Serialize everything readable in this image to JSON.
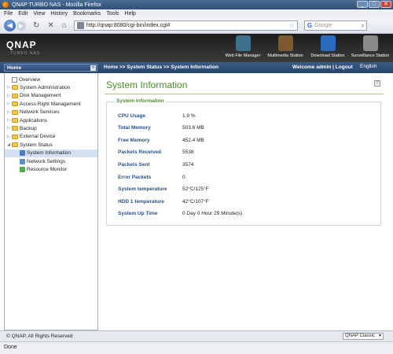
{
  "window": {
    "title": "QNAP TURBO NAS - Mozilla Firefox",
    "controls": [
      "_",
      "□",
      "✕"
    ]
  },
  "menu": [
    "File",
    "Edit",
    "View",
    "History",
    "Bookmarks",
    "Tools",
    "Help"
  ],
  "toolbar": {
    "url": "http://qnap:8080/cgi-bin/index.cgi#",
    "search_placeholder": "Google",
    "search_logo": "G"
  },
  "brand": {
    "logo": "QNAP",
    "sub": "TURBO NAS"
  },
  "apps": [
    {
      "label": "Web File Manager",
      "color": "#3d6f8f"
    },
    {
      "label": "Multimedia Station",
      "color": "#7b5a32"
    },
    {
      "label": "Download Station",
      "color": "#2b6cc0"
    },
    {
      "label": "Surveillance Station",
      "color": "#8a8a8a"
    }
  ],
  "nav": {
    "home_label": "Home",
    "breadcrumb": "Home >> System Status >> System Information",
    "welcome": "Welcome admin | Logout",
    "language": "English"
  },
  "sidebar": [
    {
      "label": "Overview",
      "kind": "doc",
      "depth": 0,
      "expander": ""
    },
    {
      "label": "System Administration",
      "kind": "folder",
      "depth": 0,
      "expander": "▷"
    },
    {
      "label": "Disk Management",
      "kind": "folder",
      "depth": 0,
      "expander": "▷"
    },
    {
      "label": "Access Right Management",
      "kind": "folder",
      "depth": 0,
      "expander": "▷"
    },
    {
      "label": "Network Services",
      "kind": "folder",
      "depth": 0,
      "expander": "▷"
    },
    {
      "label": "Applications",
      "kind": "folder",
      "depth": 0,
      "expander": "▷"
    },
    {
      "label": "Backup",
      "kind": "folder",
      "depth": 0,
      "expander": "▷"
    },
    {
      "label": "External Device",
      "kind": "folder",
      "depth": 0,
      "expander": "▷"
    },
    {
      "label": "System Status",
      "kind": "folder",
      "depth": 0,
      "expander": "◢"
    },
    {
      "label": "System Information",
      "kind": "leaf",
      "depth": 1,
      "expander": "",
      "selected": true,
      "color": "#4a7bc4"
    },
    {
      "label": "Network Settings",
      "kind": "leaf",
      "depth": 1,
      "expander": "",
      "color": "#5a8fd0"
    },
    {
      "label": "Resource Monitor",
      "kind": "leaf",
      "depth": 1,
      "expander": "",
      "color": "#4caf50"
    }
  ],
  "main": {
    "title": "System Information",
    "section": "System Information",
    "rows": [
      {
        "key": "CPU Usage",
        "value": "1.9 %"
      },
      {
        "key": "Total Memory",
        "value": "503.6 MB"
      },
      {
        "key": "Free Memory",
        "value": "452.4 MB"
      },
      {
        "key": "Packets Received",
        "value": "5538"
      },
      {
        "key": "Packets Sent",
        "value": "3574"
      },
      {
        "key": "Error Packets",
        "value": "0"
      },
      {
        "key": "System temperature",
        "value": "52°C/125°F"
      },
      {
        "key": "HDD 1 temperature",
        "value": "42°C/107°F"
      },
      {
        "key": "System Up Time",
        "value": "0 Day 0 Hour 29 Minute(s)"
      }
    ]
  },
  "footer": {
    "copyright": "© QNAP, All Rights Reserved",
    "theme": "QNAP Classic"
  },
  "status": "Done"
}
